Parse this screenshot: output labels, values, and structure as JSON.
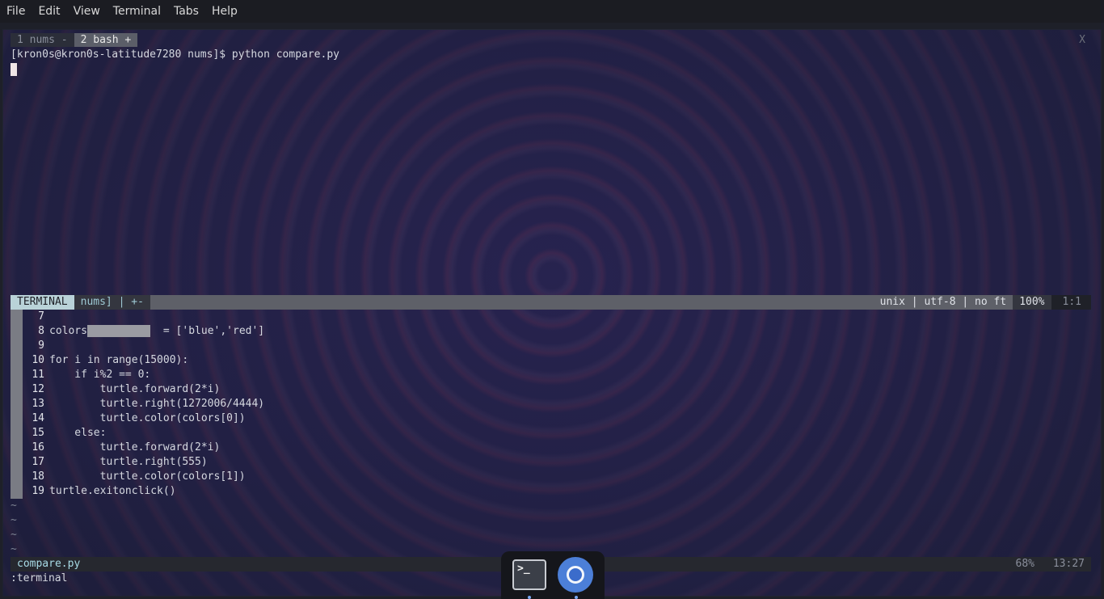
{
  "menu": [
    "File",
    "Edit",
    "View",
    "Terminal",
    "Tabs",
    "Help"
  ],
  "tabs": {
    "tab1": "1 nums -",
    "tab2": "2 bash +",
    "close": "X"
  },
  "shell": {
    "prompt_line": "[kron0s@kron0s-latitude7280 nums]$ python compare.py"
  },
  "statusline": {
    "mode": "TERMINAL",
    "path": "nums] | +-",
    "encoding": "unix | utf-8 | no ft",
    "percent": "100%",
    "position": "1:1"
  },
  "code": {
    "line_numbers": [
      "7",
      "8",
      "9",
      "10",
      "11",
      "12",
      "13",
      "14",
      "15",
      "16",
      "17",
      "18",
      "19"
    ],
    "lines": [
      "",
      "colors",
      "",
      "for i in range(15000):",
      "    if i%2 == 0:",
      "        turtle.forward(2*i)",
      "        turtle.right(1272006/4444)",
      "        turtle.color(colors[0])",
      "    else:",
      "        turtle.forward(2*i)",
      "        turtle.right(555)",
      "        turtle.color(colors[1])",
      "turtle.exitonclick()"
    ],
    "line8_rest": "  = ['blue','red']",
    "tilde": "~"
  },
  "buffer": {
    "filename": "compare.py",
    "percent": "68%",
    "position": "13:27"
  },
  "command_line": ":terminal",
  "dock": {
    "terminal_icon_glyph": ">_",
    "items": [
      "terminal-icon",
      "chromium-icon"
    ]
  }
}
